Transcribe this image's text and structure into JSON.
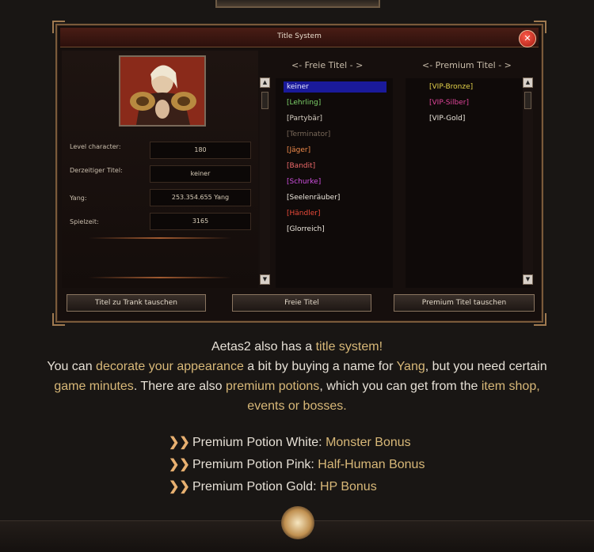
{
  "window": {
    "title": "Title System",
    "close_icon": "close-icon"
  },
  "stats": [
    {
      "label": "Level character:",
      "value": "180"
    },
    {
      "label": "Derzeitiger Titel:",
      "value": "keiner"
    },
    {
      "label": "Yang:",
      "value": "253.354.655 Yang"
    },
    {
      "label": "Spielzeit:",
      "value": "3165"
    }
  ],
  "free_titles": {
    "header": "<- Freie Titel - >",
    "items": [
      {
        "label": "keiner",
        "color": "#e6e6ff",
        "selected": true
      },
      {
        "label": "[Lehrling]",
        "color": "#7ed36a"
      },
      {
        "label": "[Partybär]",
        "color": "#d8d0c4"
      },
      {
        "label": "[Terminator]",
        "color": "#7a6a5a"
      },
      {
        "label": "[Jäger]",
        "color": "#f08a4a"
      },
      {
        "label": "[Bandit]",
        "color": "#f06a6a"
      },
      {
        "label": "[Schurke]",
        "color": "#d050e0"
      },
      {
        "label": "[Seelenräuber]",
        "color": "#ece6dc"
      },
      {
        "label": "[Händler]",
        "color": "#ec4a3a"
      },
      {
        "label": "[Glorreich]",
        "color": "#ece6dc"
      }
    ]
  },
  "premium_titles": {
    "header": "<- Premium Titel - >",
    "items": [
      {
        "label": "[VIP-Bronze]",
        "color": "#e4d24a"
      },
      {
        "label": "[VIP-Silber]",
        "color": "#e0449a"
      },
      {
        "label": "[VIP-Gold]",
        "color": "#ece6dc"
      }
    ]
  },
  "buttons": {
    "trade": "Titel zu Trank tauschen",
    "free": "Freie Titel",
    "premium": "Premium Titel tauschen"
  },
  "text": {
    "l1a": "Aetas2 also has a ",
    "l1b": "title system!",
    "l2a": "You can ",
    "l2b": "decorate your appearance",
    "l2c": " a bit by buying a name for ",
    "l2d": "Yang",
    "l2e": ", but you need certain",
    "l3a": "game minutes",
    "l3b": ". There are also ",
    "l3c": "premium potions",
    "l3d": ", which you can get from the ",
    "l3e": "item shop,",
    "l4": "events or bosses."
  },
  "potions": [
    {
      "label": "Premium Potion White: ",
      "bonus": "Monster Bonus"
    },
    {
      "label": "Premium Potion Pink: ",
      "bonus": "Half-Human Bonus"
    },
    {
      "label": "Premium Potion Gold: ",
      "bonus": "HP Bonus"
    }
  ],
  "colors": {
    "accent": "#d8b878",
    "window_bg": "#160f0d",
    "border": "#7a5a3a"
  }
}
